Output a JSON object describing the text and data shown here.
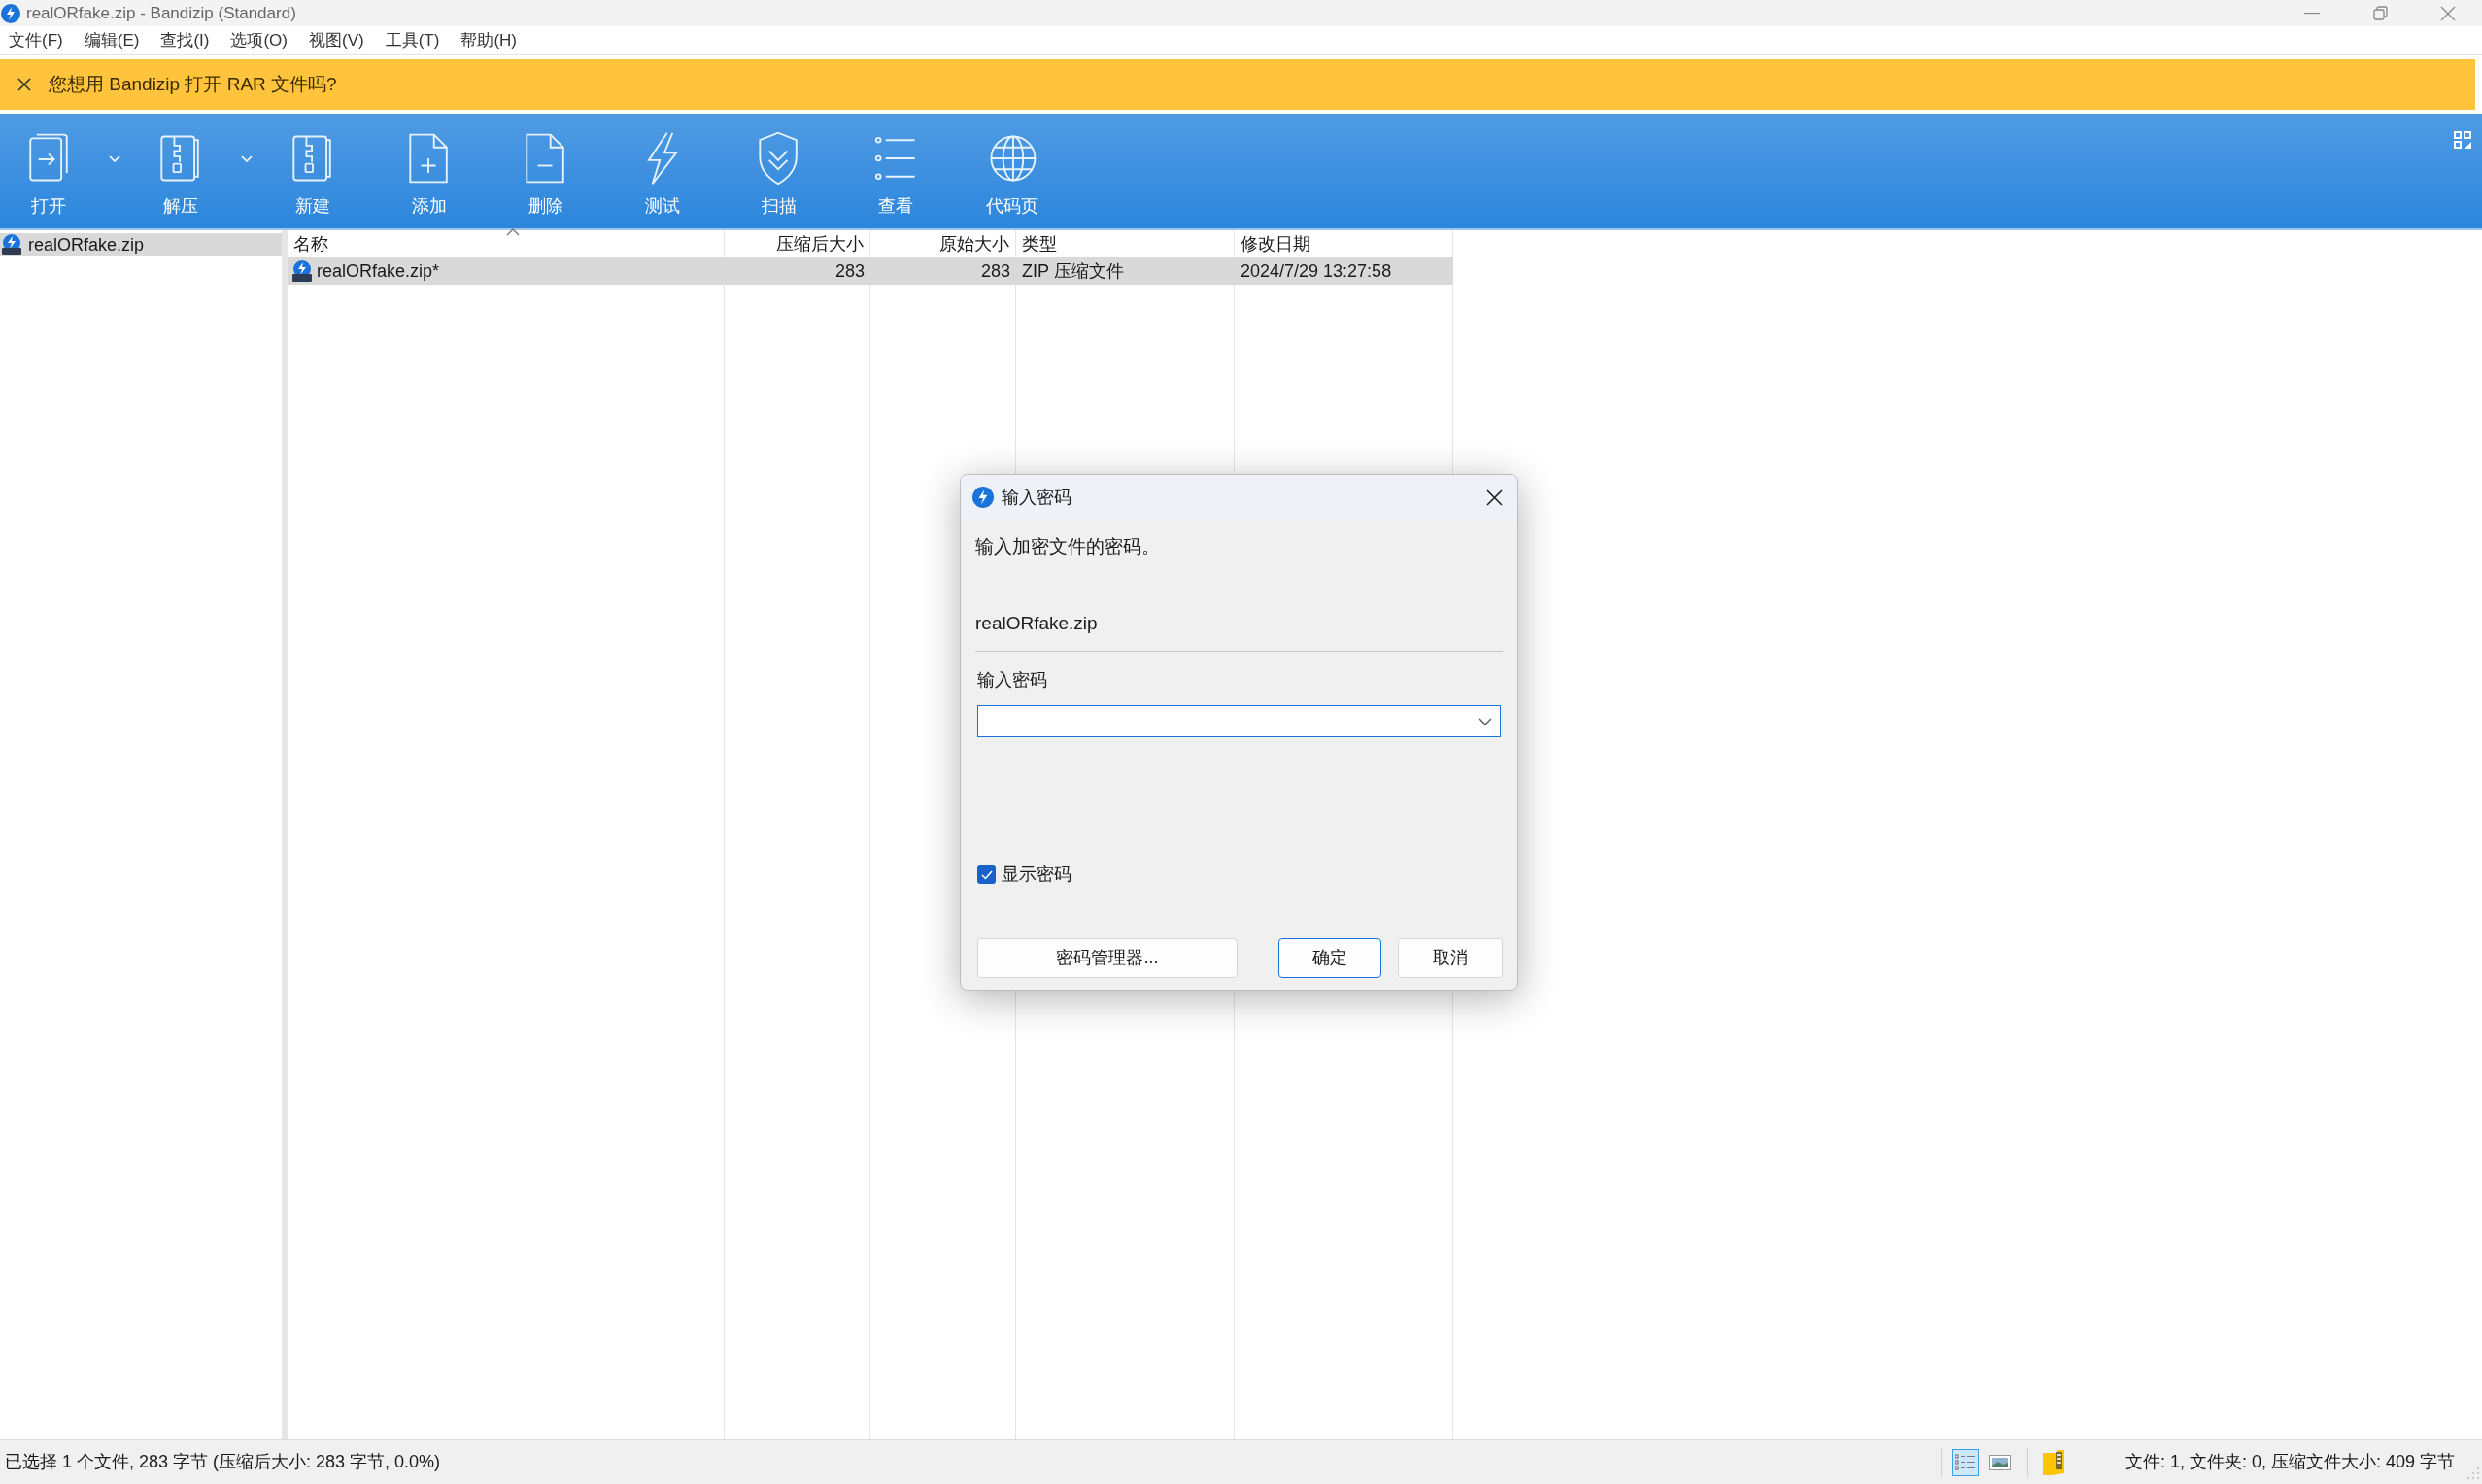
{
  "window": {
    "title": "realORfake.zip - Bandizip (Standard)"
  },
  "menu": [
    "文件(F)",
    "编辑(E)",
    "查找(I)",
    "选项(O)",
    "视图(V)",
    "工具(T)",
    "帮助(H)"
  ],
  "banner": {
    "text": "您想用 Bandizip 打开 RAR 文件吗?"
  },
  "toolbar": [
    {
      "label": "打开",
      "kind": "open",
      "dropdown": true
    },
    {
      "label": "解压",
      "kind": "extract",
      "dropdown": true
    },
    {
      "label": "新建",
      "kind": "new",
      "dropdown": false
    },
    {
      "label": "添加",
      "kind": "add",
      "dropdown": false
    },
    {
      "label": "删除",
      "kind": "delete",
      "dropdown": false
    },
    {
      "label": "测试",
      "kind": "test",
      "dropdown": false
    },
    {
      "label": "扫描",
      "kind": "scan",
      "dropdown": false
    },
    {
      "label": "查看",
      "kind": "view",
      "dropdown": false
    },
    {
      "label": "代码页",
      "kind": "codepage",
      "dropdown": false
    }
  ],
  "tree": [
    {
      "label": "realORfake.zip",
      "selected": true
    }
  ],
  "table": {
    "columns": [
      {
        "label": "名称",
        "kind": "text",
        "sorted": true
      },
      {
        "label": "压缩后大小",
        "kind": "number",
        "sorted": false
      },
      {
        "label": "原始大小",
        "kind": "number",
        "sorted": false
      },
      {
        "label": "类型",
        "kind": "text",
        "sorted": false
      },
      {
        "label": "修改日期",
        "kind": "text",
        "sorted": false
      }
    ],
    "rows": [
      {
        "cells": [
          "realORfake.zip*",
          "283",
          "283",
          "ZIP 压缩文件",
          "2024/7/29 13:27:58"
        ],
        "selected": true
      }
    ]
  },
  "dialog": {
    "title": "输入密码",
    "message": "输入加密文件的密码。",
    "filename": "realORfake.zip",
    "password_label": "输入密码",
    "password_field": {
      "focused": true
    },
    "show_password": {
      "label": "显示密码",
      "checked": true
    },
    "buttons": [
      {
        "label": "密码管理器...",
        "default": false
      },
      {
        "label": "确定",
        "default": true
      },
      {
        "label": "取消",
        "default": false
      }
    ]
  },
  "status_bar": {
    "left": "已选择 1 个文件, 283 字节 (压缩后大小: 283 字节, 0.0%)",
    "view_modes": [
      {
        "kind": "details",
        "selected": true
      },
      {
        "kind": "thumbnails",
        "selected": false
      }
    ],
    "right": "文件: 1, 文件夹: 0, 压缩文件大小: 409 字节"
  }
}
